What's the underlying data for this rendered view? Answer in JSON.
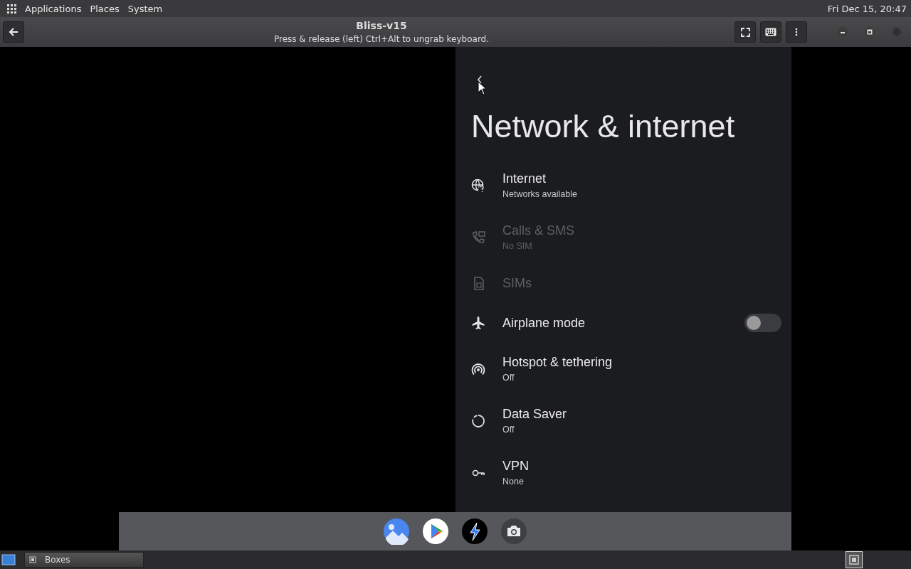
{
  "top_panel": {
    "menus": [
      "Applications",
      "Places",
      "System"
    ],
    "clock": "Fri Dec 15, 20:47"
  },
  "header": {
    "title": "Bliss-v15",
    "subtitle": "Press & release (left) Ctrl+Alt to ungrab keyboard."
  },
  "settings": {
    "title": "Network & internet",
    "items": [
      {
        "kind": "nav",
        "title": "Internet",
        "summary": "Networks available",
        "disabled": false
      },
      {
        "kind": "nav",
        "title": "Calls & SMS",
        "summary": "No SIM",
        "disabled": true
      },
      {
        "kind": "nav",
        "title": "SIMs",
        "disabled": true
      },
      {
        "kind": "toggle",
        "title": "Airplane mode",
        "on": false,
        "disabled": false
      },
      {
        "kind": "nav",
        "title": "Hotspot & tethering",
        "summary": "Off",
        "disabled": false
      },
      {
        "kind": "nav",
        "title": "Data Saver",
        "summary": "Off",
        "disabled": false
      },
      {
        "kind": "nav",
        "title": "VPN",
        "summary": "None",
        "disabled": false
      }
    ]
  },
  "taskbar": {
    "windows": [
      {
        "label": "Boxes",
        "selected": false
      }
    ]
  }
}
